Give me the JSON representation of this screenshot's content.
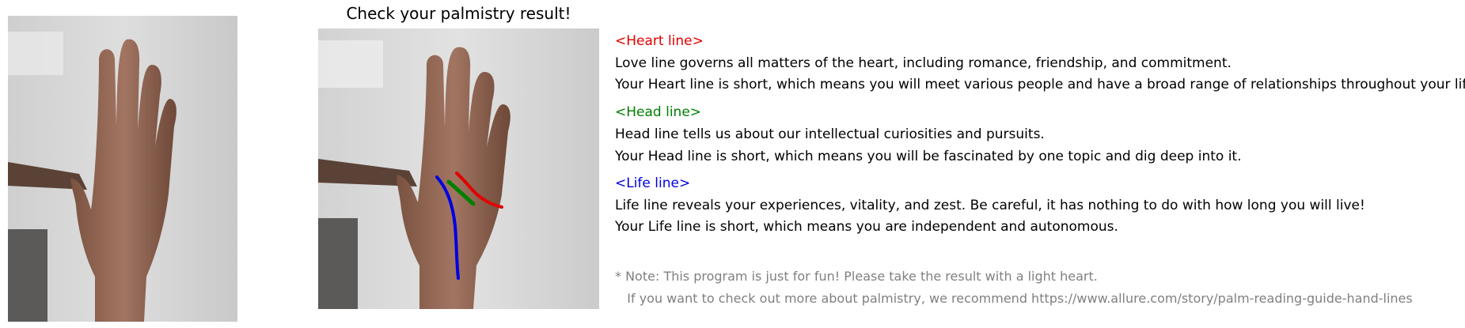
{
  "title": "Check your palmistry result!",
  "images": {
    "left": "hand-photo-original",
    "right": "hand-photo-with-lines"
  },
  "colors": {
    "heart": "#e00000",
    "head": "#008000",
    "life": "#0000e0",
    "note": "#808080"
  },
  "sections": {
    "heart": {
      "header": "<Heart line>",
      "line1": "Love line governs all matters of the heart, including romance, friendship, and commitment.",
      "line2": "Your Heart line is short, which means you will meet various people and have a broad range of relationships throughout your life."
    },
    "head": {
      "header": "<Head line>",
      "line1": "Head line tells us about our intellectual curiosities and pursuits.",
      "line2": "Your Head line is short, which means you will be fascinated by one topic and dig deep into it."
    },
    "life": {
      "header": "<Life line>",
      "line1": "Life line reveals your experiences, vitality, and zest. Be careful, it has nothing to do with how long you will live!",
      "line2": "Your Life line is short, which means you are independent and autonomous."
    }
  },
  "note": {
    "line1": "* Note: This program is just for fun! Please take the result with a light heart.",
    "line2": "   If you want to check out more about palmistry, we recommend https://www.allure.com/story/palm-reading-guide-hand-lines"
  }
}
